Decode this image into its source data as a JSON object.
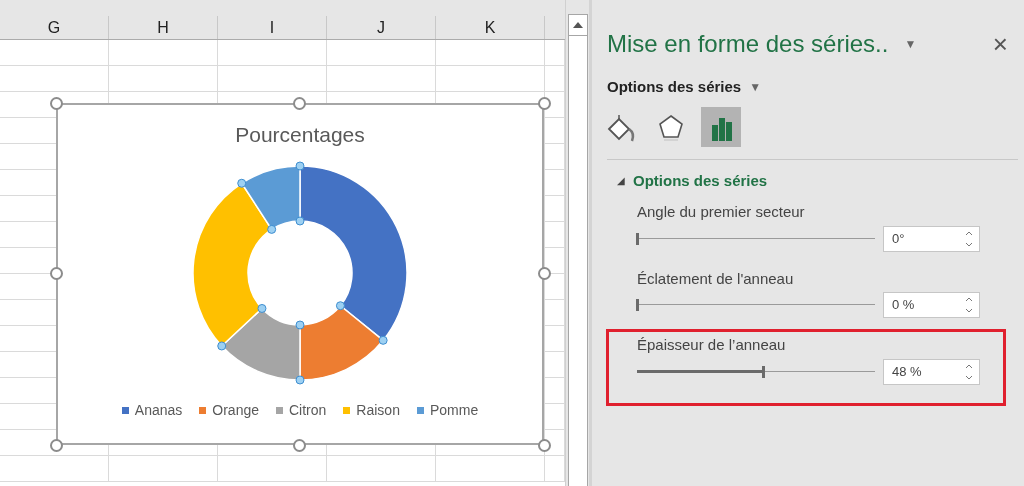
{
  "sheet": {
    "columns": [
      "G",
      "H",
      "I",
      "J",
      "K"
    ]
  },
  "chart": {
    "title": "Pourcentages",
    "selected": true,
    "legend": [
      {
        "label": "Ananas",
        "color": "#4472c4"
      },
      {
        "label": "Orange",
        "color": "#ed7d31"
      },
      {
        "label": "Citron",
        "color": "#a5a5a5"
      },
      {
        "label": "Raison",
        "color": "#ffc000"
      },
      {
        "label": "Pomme",
        "color": "#5b9bd5"
      }
    ]
  },
  "panel": {
    "title": "Mise en forme des séries..",
    "title_menu": "▼",
    "close": "×",
    "subtitle": "Options des séries",
    "subtitle_menu": "▼",
    "icon_tabs": [
      {
        "kind": "fill",
        "selected": false
      },
      {
        "kind": "effects",
        "selected": false
      },
      {
        "kind": "options",
        "selected": true
      }
    ],
    "section": {
      "toggle": "◢",
      "label": "Options des séries",
      "expanded": true
    },
    "options": [
      {
        "label": "Angle du premier secteur",
        "level": 0,
        "value": "0°",
        "highlighted": false
      },
      {
        "label": "Éclatement de l'anneau",
        "level": 0,
        "value": "0 %",
        "highlighted": false
      },
      {
        "label": "Épaisseur de l’anneau",
        "level": 0.53,
        "value": "48 %",
        "highlighted": true
      }
    ]
  }
}
